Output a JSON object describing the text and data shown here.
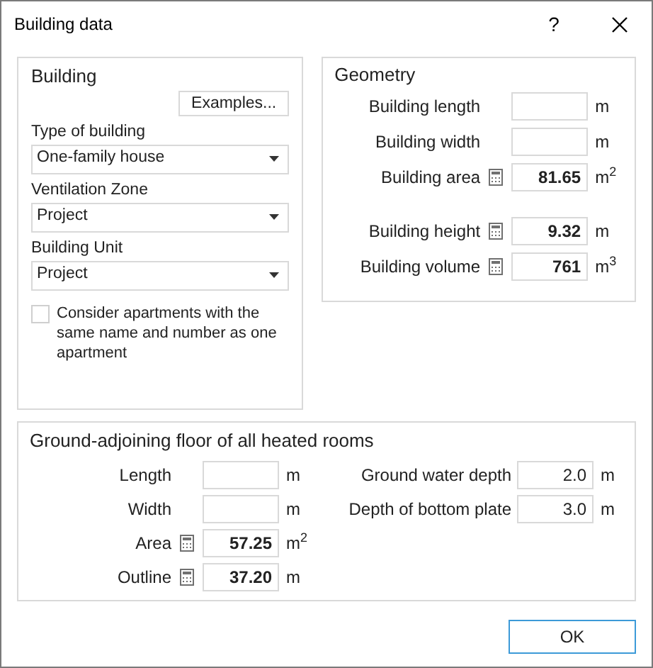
{
  "window": {
    "title": "Building data",
    "help": "?"
  },
  "building": {
    "title": "Building",
    "examples_button": "Examples...",
    "dropdowns": [
      {
        "label": "Type of building",
        "value": "One-family house"
      },
      {
        "label": "Ventilation Zone",
        "value": "Project"
      },
      {
        "label": "Building Unit",
        "value": "Project"
      }
    ],
    "checkbox": {
      "label": "Consider apartments with the same name and number as one apartment",
      "checked": false
    }
  },
  "geometry": {
    "title": "Geometry",
    "field_groups": [
      [
        {
          "label": "Building length",
          "unit": "m",
          "calculated": false
        },
        {
          "label": "Building width",
          "unit": "m",
          "calculated": false
        },
        {
          "label": "Building area",
          "value": "81.65",
          "unit": "m$^{2}$",
          "calculated": true
        }
      ],
      [
        {
          "label": "Building height",
          "value": "9.32",
          "unit": "m",
          "calculated": true
        },
        {
          "label": "Building volume",
          "value": "761",
          "unit": "m$^{3}$",
          "calculated": true
        }
      ]
    ]
  },
  "ground_floor": {
    "title": "Ground-adjoining floor of all heated rooms",
    "left_fields": [
      {
        "label": "Length",
        "unit": "m",
        "calculated": false
      },
      {
        "label": "Width",
        "unit": "m",
        "calculated": false
      },
      {
        "label": "Area",
        "value": "57.25",
        "unit": "m$^{2}$",
        "calculated": true
      },
      {
        "label": "Outline",
        "value": "37.20",
        "unit": "m",
        "calculated": true
      }
    ],
    "right_fields": [
      {
        "label": "Ground water depth",
        "value": "2.0",
        "unit": "m"
      },
      {
        "label": "Depth of bottom plate",
        "value": "3.0",
        "unit": "m"
      }
    ]
  },
  "buttons": [
    {
      "label": "OK",
      "default": true
    }
  ]
}
